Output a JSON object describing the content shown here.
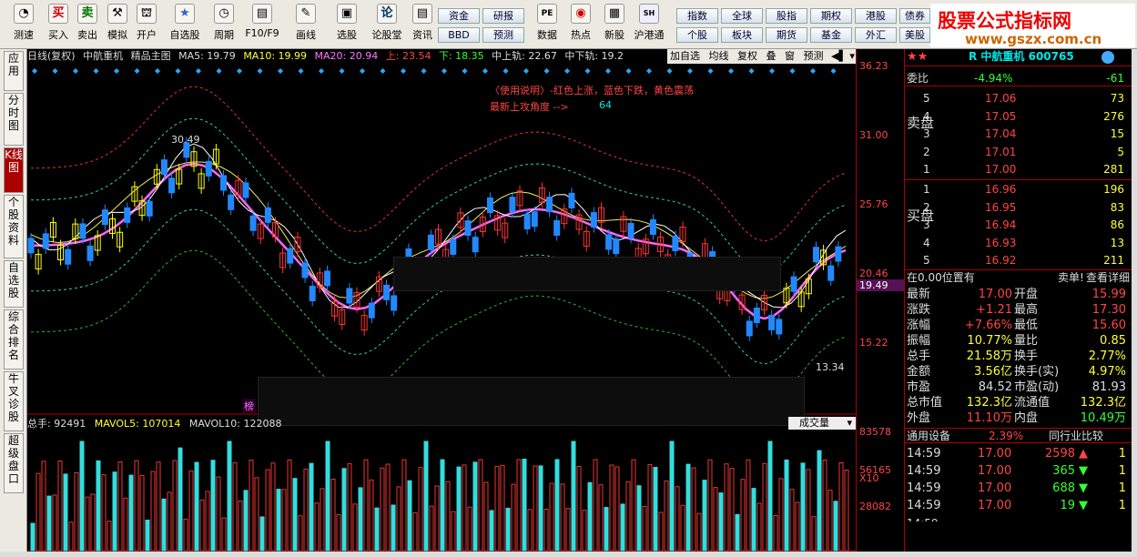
{
  "toolbar": {
    "buttons": [
      {
        "label": "测速",
        "glyph": "◔"
      },
      {
        "label": "买入",
        "glyph": "买"
      },
      {
        "label": "卖出",
        "glyph": "卖"
      },
      {
        "label": "模拟",
        "glyph": "⚒"
      },
      {
        "label": "开户",
        "glyph": "⛫"
      },
      {
        "label": "自选股",
        "glyph": "★"
      },
      {
        "label": "周期",
        "glyph": "◷"
      },
      {
        "label": "F10/F9",
        "glyph": "▤"
      },
      {
        "label": "画线",
        "glyph": "✎"
      },
      {
        "label": "选股",
        "glyph": "▣"
      },
      {
        "label": "论股堂",
        "glyph": "论"
      },
      {
        "label": "资讯",
        "glyph": "▤"
      },
      {
        "label": "数据",
        "glyph": "PE"
      },
      {
        "label": "热点",
        "glyph": "◉"
      },
      {
        "label": "新股",
        "glyph": "▦"
      },
      {
        "label": "沪港通",
        "glyph": "SH"
      }
    ],
    "group_a": [
      "资金",
      "研报",
      "BBD",
      "预测"
    ],
    "group_b": [
      "指数",
      "全球",
      "股指",
      "期权",
      "港股",
      "债券",
      "个股",
      "板块",
      "期货",
      "基金",
      "外汇",
      "美股"
    ]
  },
  "logo": {
    "title": "股票公式指标网",
    "url": "www.gszx.com.cn"
  },
  "sidebar": [
    "应用",
    "分时图",
    "K线图",
    "个股资料",
    "自选股",
    "综合排名",
    "牛叉诊股",
    "超级盘口"
  ],
  "chart_header": {
    "period": "日线(复权)",
    "stock": "中航重机",
    "formula": "精品主图",
    "ma5": "MA5: 19.79",
    "ma10": "MA10: 19.99",
    "ma20": "MA20: 20.94",
    "up": "上: 23.54",
    "down": "下: 18.35",
    "mid_up": "中上轨: 22.67",
    "mid_down": "中下轨: 19.2"
  },
  "chart_controls": [
    "加自选",
    "均线",
    "复权",
    "叠",
    "窗",
    "预测"
  ],
  "annotation": {
    "line1": "〈使用说明〉-红色上涨，蓝色下跌，黄色震荡",
    "line2": "最新上攻角度 -->",
    "angle": "64"
  },
  "price_labels": {
    "high": "30.49",
    "low": "13.34",
    "sidebox": "榜"
  },
  "price_axis": [
    "36.23",
    "31.00",
    "25.76",
    "20.46",
    "19.49",
    "15.22"
  ],
  "volume_header": {
    "total": "总手: 92491",
    "mavol5": "MAVOL5: 107014",
    "mavol10": "MAVOL10: 122088",
    "dropdown": "成交量"
  },
  "volume_axis": [
    "83578",
    "56165",
    "X10",
    "28082"
  ],
  "quote": {
    "title": "R 中航重机 600765",
    "weibi_label": "委比",
    "weibi": "-4.94%",
    "weicha": "-61",
    "sell_label": "卖盘",
    "buy_label": "买盘",
    "sell": [
      {
        "lvl": "5",
        "price": "17.06",
        "vol": "73"
      },
      {
        "lvl": "4",
        "price": "17.05",
        "vol": "276"
      },
      {
        "lvl": "3",
        "price": "17.04",
        "vol": "15"
      },
      {
        "lvl": "2",
        "price": "17.01",
        "vol": "5"
      },
      {
        "lvl": "1",
        "price": "17.00",
        "vol": "281"
      }
    ],
    "buy": [
      {
        "lvl": "1",
        "price": "16.96",
        "vol": "196"
      },
      {
        "lvl": "2",
        "price": "16.95",
        "vol": "83"
      },
      {
        "lvl": "3",
        "price": "16.94",
        "vol": "86"
      },
      {
        "lvl": "4",
        "price": "16.93",
        "vol": "13"
      },
      {
        "lvl": "5",
        "price": "16.92",
        "vol": "211"
      }
    ],
    "pos_text": "在0.00位置有",
    "sell_btn": "卖单!",
    "detail_btn": "查看详细",
    "stats": [
      {
        "l1": "最新",
        "v1": "17.00",
        "l2": "开盘",
        "v2": "15.99"
      },
      {
        "l1": "涨跌",
        "v1": "+1.21",
        "l2": "最高",
        "v2": "17.30"
      },
      {
        "l1": "涨幅",
        "v1": "+7.66%",
        "l2": "最低",
        "v2": "15.60"
      },
      {
        "l1": "振幅",
        "v1": "10.77%",
        "l2": "量比",
        "v2": "0.85"
      },
      {
        "l1": "总手",
        "v1": "21.58万",
        "l2": "换手",
        "v2": "2.77%"
      },
      {
        "l1": "金额",
        "v1": "3.56亿",
        "l2": "换手(实)",
        "v2": "4.97%"
      },
      {
        "l1": "市盈",
        "v1": "84.52",
        "l2": "市盈(动)",
        "v2": "81.93"
      },
      {
        "l1": "总市值",
        "v1": "132.3亿",
        "l2": "流通值",
        "v2": "132.3亿"
      },
      {
        "l1": "外盘",
        "v1": "11.10万",
        "l2": "内盘",
        "v2": "10.49万"
      }
    ],
    "device_label": "通用设备",
    "device_pct": "2.39%",
    "compare_label": "同行业比较",
    "ticks": [
      {
        "t": "14:59",
        "p": "17.00",
        "v": "2598",
        "n": "1"
      },
      {
        "t": "14:59",
        "p": "17.00",
        "v": "365",
        "n": "1"
      },
      {
        "t": "14:59",
        "p": "17.00",
        "v": "688",
        "n": "1"
      },
      {
        "t": "14:59",
        "p": "17.00",
        "v": "19",
        "n": "1"
      }
    ]
  }
}
